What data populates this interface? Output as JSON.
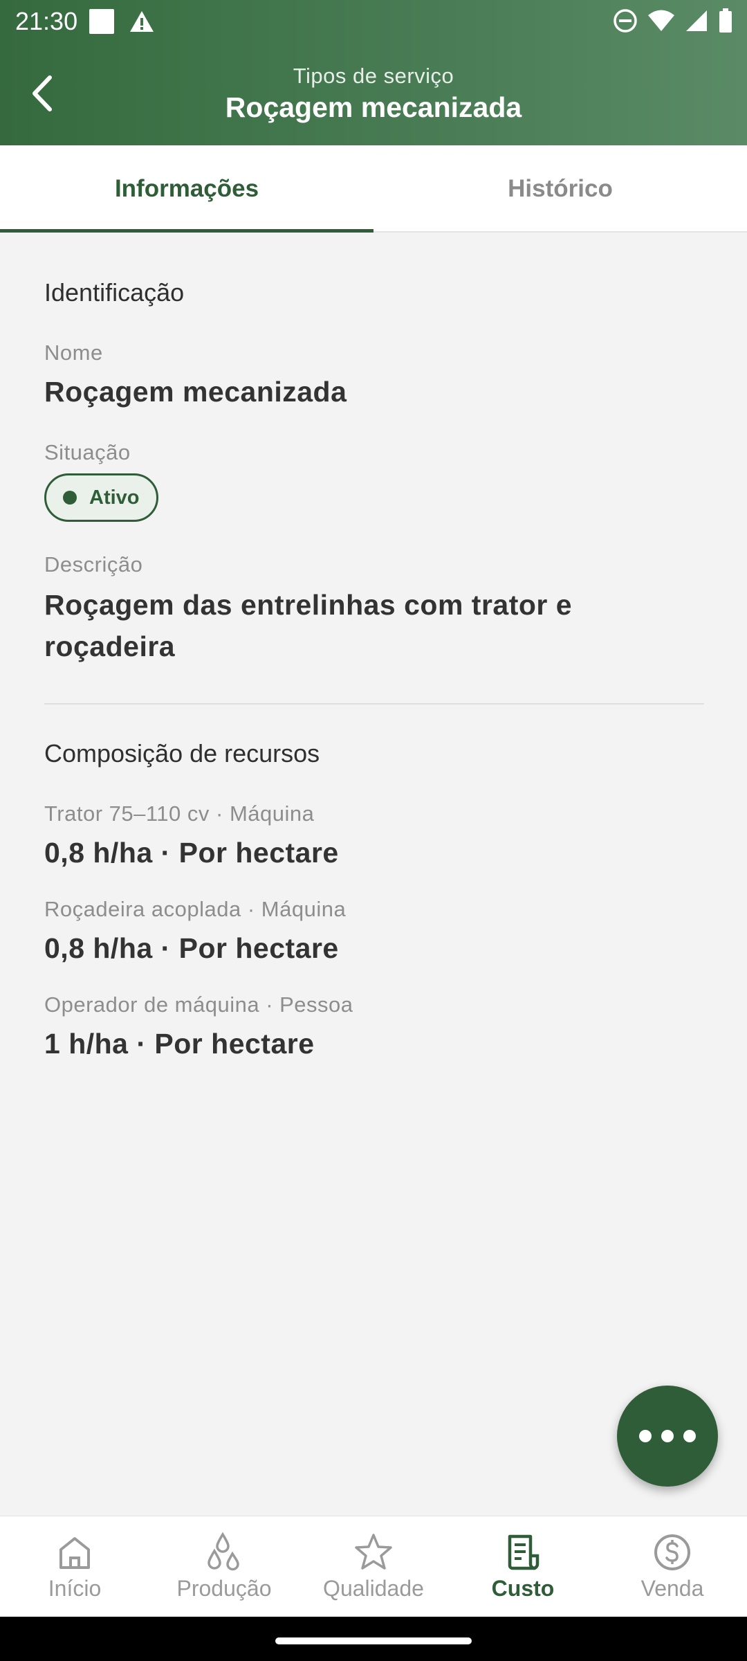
{
  "status": {
    "time": "21:30"
  },
  "header": {
    "subtitle": "Tipos de serviço",
    "title": "Roçagem mecanizada"
  },
  "tabs": [
    {
      "label": "Informações",
      "active": true
    },
    {
      "label": "Histórico",
      "active": false
    }
  ],
  "identification": {
    "section_title": "Identificação",
    "name_label": "Nome",
    "name_value": "Roçagem mecanizada",
    "status_label": "Situação",
    "status_value": "Ativo",
    "description_label": "Descrição",
    "description_value": "Roçagem das entrelinhas com trator e roçadeira"
  },
  "resources": {
    "section_title": "Composição de recursos",
    "items": [
      {
        "label": "Trator 75–110 cv · Máquina",
        "value": "0,8 h/ha · Por hectare"
      },
      {
        "label": "Roçadeira acoplada · Máquina",
        "value": "0,8 h/ha · Por hectare"
      },
      {
        "label": "Operador de máquina · Pessoa",
        "value": "1 h/ha · Por hectare"
      }
    ]
  },
  "bottom_nav": [
    {
      "label": "Início",
      "icon": "home-icon",
      "active": false
    },
    {
      "label": "Produção",
      "icon": "drops-icon",
      "active": false
    },
    {
      "label": "Qualidade",
      "icon": "star-icon",
      "active": false
    },
    {
      "label": "Custo",
      "icon": "receipt-icon",
      "active": true
    },
    {
      "label": "Venda",
      "icon": "dollar-icon",
      "active": false
    }
  ],
  "colors": {
    "primary": "#2f5d38",
    "header": "#3f7349",
    "background": "#f3f3f3"
  }
}
